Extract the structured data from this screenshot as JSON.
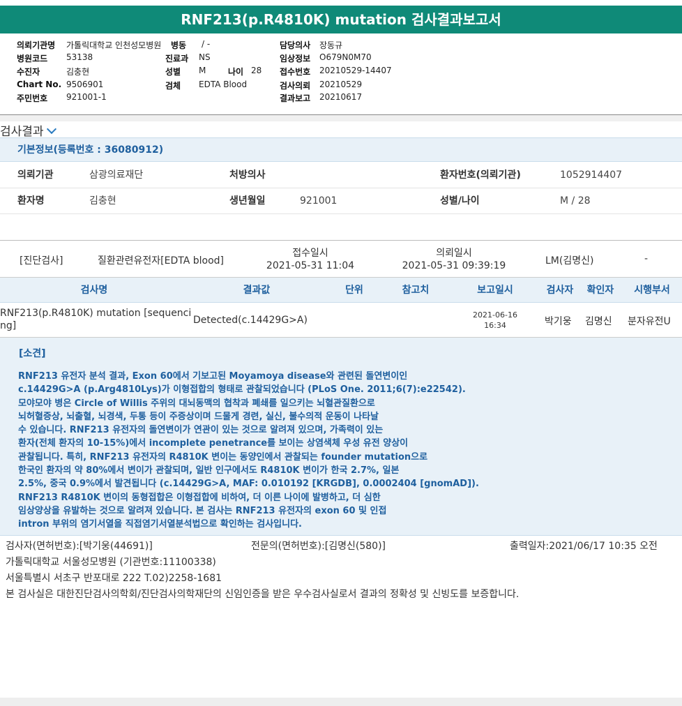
{
  "report_title": "RNF213(p.R4810K) mutation 검사결과보고서",
  "header": {
    "institution_label": "의뢰기관명",
    "institution_value": "가톨릭대학교 인천성모병원",
    "ward_label": "병동",
    "ward_value": "/ -",
    "doctor_label": "담당의사",
    "doctor_value": "장동규",
    "hospital_code_label": "병원코드",
    "hospital_code_value": "53138",
    "dept_label": "진료과",
    "dept_value": "NS",
    "clinical_label": "임상정보",
    "clinical_value": "O679N0M70",
    "collector_label": "수진자",
    "collector_value": "김충현",
    "sex_label": "성별",
    "sex_value": "M",
    "age_label": "나이",
    "age_value": "28",
    "receipt_no_label": "접수번호",
    "receipt_no_value": "20210529-14407",
    "chart_label": "Chart No.",
    "chart_value": "9506901",
    "specimen_label": "검체",
    "specimen_value": "EDTA Blood",
    "request_label": "검사의뢰",
    "request_value": "20210529",
    "resident_label": "주민번호",
    "resident_value": "921001-1",
    "report_label": "결과보고",
    "report_value": "20210617"
  },
  "results_section_title": "검사결과",
  "basic_info": {
    "heading": "기본정보(등록번호 : 36080912)",
    "ref_org_label": "의뢰기관",
    "ref_org_value": "삼광의료재단",
    "prescriber_label": "처방의사",
    "prescriber_value": "",
    "patient_no_label": "환자번호(의뢰기관)",
    "patient_no_value": "1052914407",
    "patient_name_label": "환자명",
    "patient_name_value": "김충현",
    "dob_label": "생년월일",
    "dob_value": "921001",
    "sex_age_label": "성별/나이",
    "sex_age_value": "M / 28"
  },
  "order": {
    "category": "[진단검사]",
    "test_group": "질환관련유전자[EDTA blood]",
    "receipt_label": "접수일시",
    "receipt_value": "2021-05-31 11:04",
    "request_label": "의뢰일시",
    "request_value": "2021-05-31 09:39:19",
    "lm": "LM(김명신)",
    "dash": "-"
  },
  "table": {
    "headers": [
      "검사명",
      "결과값",
      "단위",
      "참고치",
      "보고일시",
      "검사자",
      "확인자",
      "시행부서"
    ],
    "row": {
      "test_name_line1": "RNF213(p.R4810K) mutation [sequenci",
      "test_name_line2": "ng]",
      "result": "Detected(c.14429G>A)",
      "unit": "",
      "reference": "",
      "report_date": "2021-06-16",
      "report_time": "16:34",
      "tester": "박기웅",
      "confirmer": "김명신",
      "department": "분자유전U"
    }
  },
  "opinion": {
    "heading": "[소견]",
    "lines": [
      "RNF213 유전자 분석 결과, Exon 60에서 기보고된 Moyamoya disease와 관련된 돌연변이인",
      "c.14429G>A (p.Arg4810Lys)가 이형접합의 형태로 관찰되었습니다 (PLoS One. 2011;6(7):e22542).",
      "모야모야 병은 Circle of Willis 주위의 대뇌동맥의 협착과 폐쇄를 일으키는 뇌혈관질환으로",
      "뇌허혈증상, 뇌출혈, 뇌경색, 두통 등이 주증상이며 드물게 경련, 실신, 불수의적 운동이 나타날",
      "수 있습니다. RNF213 유전자의 돌연변이가 연관이 있는 것으로 알려져 있으며, 가족력이 있는",
      "환자(전체 환자의 10-15%)에서 incomplete penetrance를 보이는 상염색체 우성 유전 양상이",
      "관찰됩니다. 특히, RNF213 유전자의 R4810K 변이는 동양인에서 관찰되는 founder mutation으로",
      "한국인 환자의 약 80%에서 변이가 관찰되며, 일반 인구에서도 R4810K 변이가 한국 2.7%, 일본",
      "2.5%, 중국 0.9%에서 발견됩니다 (c.14429G>A, MAF: 0.010192 [KRGDB], 0.0002404 [gnomAD]).",
      "RNF213 R4810K 변이의 동형접합은 이형접합에 비하여, 더 이른 나이에 발병하고, 더 심한",
      "임상양상을 유발하는 것으로 알려져 있습니다. 본 검사는 RNF213 유전자의 exon 60 및 인접",
      "intron 부위의 염기서열을 직접염기서열분석법으로 확인하는 검사입니다."
    ]
  },
  "footer": {
    "tester_sig": "검사자(면허번호):[박기웅(44691)]",
    "specialist_sig": "전문의(면허번호):[김명신(580)]",
    "print_date": "출력일자:2021/06/17 10:35 오전",
    "hospital": "가톨릭대학교 서울성모병원 (기관번호:11100338)",
    "address": "서울특별시 서초구 반포대로 222 T.02)2258-1681",
    "certification": "본 검사실은 대한진단검사의학회/진단검사의학재단의 신임인증을 받은 우수검사실로서 결과의 정확성 및 신빙도를 보증합니다."
  },
  "colors": {
    "title_bar": "#0f8a78",
    "section_bg": "#e8f1f8",
    "accent_text": "#1e5f9e"
  }
}
